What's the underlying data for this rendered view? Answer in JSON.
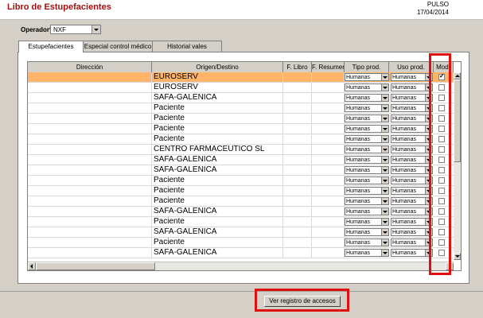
{
  "app": {
    "title": "Libro de Estupefacientes",
    "company": "PULSO",
    "date": "17/04/2014"
  },
  "operator": {
    "label": "Operador*",
    "value": "NXF"
  },
  "tabs": [
    {
      "label": "Estupefacientes",
      "active": true
    },
    {
      "label": "Especial control médico",
      "active": false
    },
    {
      "label": "Historial vales",
      "active": false
    }
  ],
  "table": {
    "columns": {
      "direccion": "Dirección",
      "origen": "Origen/Destino",
      "flibro": "F. Libro",
      "fresumen": "F. Resumen",
      "tipo": "Tipo prod.",
      "uso": "Uso prod.",
      "mod": "Mod."
    },
    "rows": [
      {
        "origen": "EUROSERV",
        "tipo": "Humanas",
        "uso": "Humanas",
        "mod": true,
        "selected": true
      },
      {
        "origen": "EUROSERV",
        "tipo": "Humanas",
        "uso": "Humanas",
        "mod": false
      },
      {
        "origen": "SAFA-GALENICA",
        "tipo": "Humanas",
        "uso": "Humanas",
        "mod": false
      },
      {
        "origen": "Paciente",
        "tipo": "Humanas",
        "uso": "Humanas",
        "mod": false
      },
      {
        "origen": "Paciente",
        "tipo": "Humanas",
        "uso": "Humanas",
        "mod": false
      },
      {
        "origen": "Paciente",
        "tipo": "Humanas",
        "uso": "Humanas",
        "mod": false
      },
      {
        "origen": "Paciente",
        "tipo": "Humanas",
        "uso": "Humanas",
        "mod": false
      },
      {
        "origen": "CENTRO FARMACEUTICO SL",
        "tipo": "Humanas",
        "uso": "Humanas",
        "mod": false
      },
      {
        "origen": "SAFA-GALENICA",
        "tipo": "Humanas",
        "uso": "Humanas",
        "mod": false
      },
      {
        "origen": "SAFA-GALENICA",
        "tipo": "Humanas",
        "uso": "Humanas",
        "mod": false
      },
      {
        "origen": "Paciente",
        "tipo": "Humanas",
        "uso": "Humanas",
        "mod": false
      },
      {
        "origen": "Paciente",
        "tipo": "Humanas",
        "uso": "Humanas",
        "mod": false
      },
      {
        "origen": "Paciente",
        "tipo": "Humanas",
        "uso": "Humanas",
        "mod": false
      },
      {
        "origen": "SAFA-GALENICA",
        "tipo": "Humanas",
        "uso": "Humanas",
        "mod": false
      },
      {
        "origen": "Paciente",
        "tipo": "Humanas",
        "uso": "Humanas",
        "mod": false
      },
      {
        "origen": "SAFA-GALENICA",
        "tipo": "Humanas",
        "uso": "Humanas",
        "mod": false
      },
      {
        "origen": "Paciente",
        "tipo": "Humanas",
        "uso": "Humanas",
        "mod": false
      },
      {
        "origen": "SAFA-GALENICA",
        "tipo": "Humanas",
        "uso": "Humanas",
        "mod": false
      }
    ]
  },
  "footer": {
    "access_button": "Ver registro de accesos"
  },
  "colors": {
    "selected_row": "#ffb469",
    "highlight": "#e01010",
    "title": "#a01010"
  }
}
